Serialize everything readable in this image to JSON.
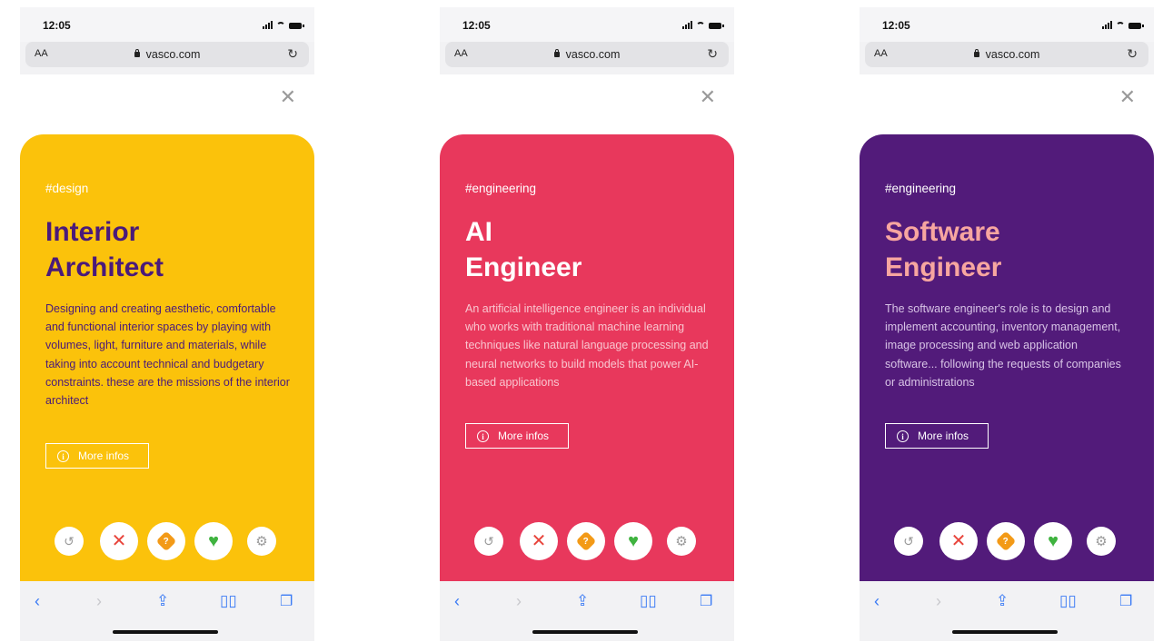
{
  "phones": [
    {
      "status_time": "12:05",
      "aa_label": "AA",
      "url": "vasco.com",
      "tag": "#design",
      "title_line1": "Interior",
      "title_line2": "Architect",
      "description": "Designing and creating aesthetic, comfortable and functional interior spaces by playing with volumes, light, furniture and materials, while taking into account technical and budgetary constraints. these are the missions of the interior architect",
      "more_label": "More infos",
      "colors": {
        "card": "#fbc20b",
        "tag": "#ffffff",
        "title": "#4a1a7a",
        "desc": "#4a1a7a",
        "more": "#ffffff"
      }
    },
    {
      "status_time": "12:05",
      "aa_label": "AA",
      "url": "vasco.com",
      "tag": "#engineering",
      "title_line1": "AI",
      "title_line2": "Engineer",
      "description": "An artificial intelligence engineer is an individual who works with traditional machine learning techniques like natural language processing and neural networks to build models that power AI-based applications",
      "more_label": "More infos",
      "colors": {
        "card": "#e8385c",
        "tag": "#ffffff",
        "title": "#ffffff",
        "desc": "#f9c5cf",
        "more": "#ffffff"
      }
    },
    {
      "status_time": "12:05",
      "aa_label": "AA",
      "url": "vasco.com",
      "tag": "#engineering",
      "title_line1": "Software",
      "title_line2": "Engineer",
      "description": "The software engineer's role is to design and implement accounting, inventory management, image processing and web application software... following the requests of companies or administrations",
      "more_label": "More infos",
      "colors": {
        "card": "#521b7a",
        "tag": "#ffffff",
        "title": "#f7a6a0",
        "desc": "#d8c4e6",
        "more": "#ffffff"
      }
    }
  ],
  "icons": {
    "close": "close-icon",
    "undo": "undo-icon",
    "dislike": "x-icon",
    "superlike": "star-icon",
    "like": "heart-icon",
    "settings": "gear-icon"
  }
}
